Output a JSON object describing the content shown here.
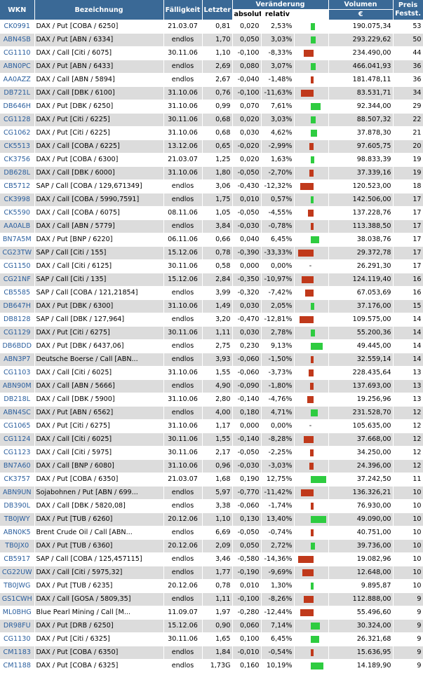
{
  "header": {
    "wkn": "WKN",
    "bezeichnung": "Bezeichnung",
    "faelligkeit": "Fälligkeit",
    "letzter": "Letzter",
    "veraenderung": "Veränderung",
    "absolut": "absolut",
    "relativ": "relativ",
    "volumen": "Volumen",
    "waehrung": "€",
    "preis_festst": "Preis Festst."
  },
  "colors": {
    "header_bg": "#3a6996",
    "positive": "#2ecc40",
    "negative": "#c0391b",
    "link": "#2b5f9e",
    "stripe": "#dcdcdc"
  },
  "rows": [
    {
      "wkn": "CK0991",
      "name": "DAX / Put [COBA / 6250]",
      "due": "21.03.07",
      "last": "0,81",
      "abs": "0,020",
      "rel": "2,53%",
      "change": 2.53,
      "vol": "190.075,34",
      "count": "53"
    },
    {
      "wkn": "ABN4SB",
      "name": "DAX / Put [ABN / 6334]",
      "due": "endlos",
      "last": "1,70",
      "abs": "0,050",
      "rel": "3,03%",
      "change": 3.03,
      "vol": "293.229,62",
      "count": "50"
    },
    {
      "wkn": "CG1110",
      "name": "DAX / Call [Citi / 6075]",
      "due": "30.11.06",
      "last": "1,10",
      "abs": "-0,100",
      "rel": "-8,33%",
      "change": -8.33,
      "vol": "234.490,00",
      "count": "44"
    },
    {
      "wkn": "ABN0PC",
      "name": "DAX / Put [ABN / 6433]",
      "due": "endlos",
      "last": "2,69",
      "abs": "0,080",
      "rel": "3,07%",
      "change": 3.07,
      "vol": "466.041,93",
      "count": "36"
    },
    {
      "wkn": "AA0AZZ",
      "name": "DAX / Call [ABN / 5894]",
      "due": "endlos",
      "last": "2,67",
      "abs": "-0,040",
      "rel": "-1,48%",
      "change": -1.48,
      "vol": "181.478,11",
      "count": "36"
    },
    {
      "wkn": "DB721L",
      "name": "DAX / Call [DBK / 6100]",
      "due": "31.10.06",
      "last": "0,76",
      "abs": "-0,100",
      "rel": "-11,63%",
      "change": -11.63,
      "vol": "83.531,71",
      "count": "34"
    },
    {
      "wkn": "DB646H",
      "name": "DAX / Put [DBK / 6250]",
      "due": "31.10.06",
      "last": "0,99",
      "abs": "0,070",
      "rel": "7,61%",
      "change": 7.61,
      "vol": "92.344,00",
      "count": "29"
    },
    {
      "wkn": "CG1128",
      "name": "DAX / Put [Citi / 6225]",
      "due": "30.11.06",
      "last": "0,68",
      "abs": "0,020",
      "rel": "3,03%",
      "change": 3.03,
      "vol": "88.507,32",
      "count": "22"
    },
    {
      "wkn": "CG1062",
      "name": "DAX / Put [Citi / 6225]",
      "due": "31.10.06",
      "last": "0,68",
      "abs": "0,030",
      "rel": "4,62%",
      "change": 4.62,
      "vol": "37.878,30",
      "count": "21"
    },
    {
      "wkn": "CK5513",
      "name": "DAX / Call [COBA / 6225]",
      "due": "13.12.06",
      "last": "0,65",
      "abs": "-0,020",
      "rel": "-2,99%",
      "change": -2.99,
      "vol": "97.605,75",
      "count": "20"
    },
    {
      "wkn": "CK3756",
      "name": "DAX / Put [COBA / 6300]",
      "due": "21.03.07",
      "last": "1,25",
      "abs": "0,020",
      "rel": "1,63%",
      "change": 1.63,
      "vol": "98.833,39",
      "count": "19"
    },
    {
      "wkn": "DB628L",
      "name": "DAX / Call [DBK / 6000]",
      "due": "31.10.06",
      "last": "1,80",
      "abs": "-0,050",
      "rel": "-2,70%",
      "change": -2.7,
      "vol": "37.339,16",
      "count": "19"
    },
    {
      "wkn": "CB5712",
      "name": "SAP / Call [COBA / 129,671349]",
      "due": "endlos",
      "last": "3,06",
      "abs": "-0,430",
      "rel": "-12,32%",
      "change": -12.32,
      "vol": "120.523,00",
      "count": "18"
    },
    {
      "wkn": "CK3998",
      "name": "DAX / Call [COBA / 5990,7591]",
      "due": "endlos",
      "last": "1,75",
      "abs": "0,010",
      "rel": "0,57%",
      "change": 0.57,
      "vol": "142.506,00",
      "count": "17"
    },
    {
      "wkn": "CK5590",
      "name": "DAX / Call [COBA / 6075]",
      "due": "08.11.06",
      "last": "1,05",
      "abs": "-0,050",
      "rel": "-4,55%",
      "change": -4.55,
      "vol": "137.228,76",
      "count": "17"
    },
    {
      "wkn": "AA0ALB",
      "name": "DAX / Call [ABN / 5779]",
      "due": "endlos",
      "last": "3,84",
      "abs": "-0,030",
      "rel": "-0,78%",
      "change": -0.78,
      "vol": "113.388,50",
      "count": "17"
    },
    {
      "wkn": "BN7A5M",
      "name": "DAX / Put [BNP / 6220]",
      "due": "06.11.06",
      "last": "0,66",
      "abs": "0,040",
      "rel": "6,45%",
      "change": 6.45,
      "vol": "38.038,76",
      "count": "17"
    },
    {
      "wkn": "CG23TW",
      "name": "SAP / Call [Citi / 155]",
      "due": "15.12.06",
      "last": "0,78",
      "abs": "-0,390",
      "rel": "-33,33%",
      "change": -33.33,
      "vol": "29.372,78",
      "count": "17"
    },
    {
      "wkn": "CG1150",
      "name": "DAX / Call [Citi / 6125]",
      "due": "30.11.06",
      "last": "0,58",
      "abs": "0,000",
      "rel": "0,00%",
      "change": 0,
      "vol": "26.291,30",
      "count": "17"
    },
    {
      "wkn": "CG21NF",
      "name": "SAP / Call [Citi / 135]",
      "due": "15.12.06",
      "last": "2,84",
      "abs": "-0,350",
      "rel": "-10,97%",
      "change": -10.97,
      "vol": "124.119,40",
      "count": "16"
    },
    {
      "wkn": "CB5585",
      "name": "SAP / Call [COBA / 121,21854]",
      "due": "endlos",
      "last": "3,99",
      "abs": "-0,320",
      "rel": "-7,42%",
      "change": -7.42,
      "vol": "67.053,69",
      "count": "16"
    },
    {
      "wkn": "DB647H",
      "name": "DAX / Put [DBK / 6300]",
      "due": "31.10.06",
      "last": "1,49",
      "abs": "0,030",
      "rel": "2,05%",
      "change": 2.05,
      "vol": "37.176,00",
      "count": "15"
    },
    {
      "wkn": "DB8128",
      "name": "SAP / Call [DBK / 127,964]",
      "due": "endlos",
      "last": "3,20",
      "abs": "-0,470",
      "rel": "-12,81%",
      "change": -12.81,
      "vol": "109.575,00",
      "count": "14"
    },
    {
      "wkn": "CG1129",
      "name": "DAX / Put [Citi / 6275]",
      "due": "30.11.06",
      "last": "1,11",
      "abs": "0,030",
      "rel": "2,78%",
      "change": 2.78,
      "vol": "55.200,36",
      "count": "14"
    },
    {
      "wkn": "DB6BDD",
      "name": "DAX / Put [DBK / 6437,06]",
      "due": "endlos",
      "last": "2,75",
      "abs": "0,230",
      "rel": "9,13%",
      "change": 9.13,
      "vol": "49.445,00",
      "count": "14"
    },
    {
      "wkn": "ABN3P7",
      "name": "Deutsche Boerse / Call [ABN...",
      "due": "endlos",
      "last": "3,93",
      "abs": "-0,060",
      "rel": "-1,50%",
      "change": -1.5,
      "vol": "32.559,14",
      "count": "14"
    },
    {
      "wkn": "CG1103",
      "name": "DAX / Call [Citi / 6025]",
      "due": "31.10.06",
      "last": "1,55",
      "abs": "-0,060",
      "rel": "-3,73%",
      "change": -3.73,
      "vol": "228.435,64",
      "count": "13"
    },
    {
      "wkn": "ABN90M",
      "name": "DAX / Call [ABN / 5666]",
      "due": "endlos",
      "last": "4,90",
      "abs": "-0,090",
      "rel": "-1,80%",
      "change": -1.8,
      "vol": "137.693,00",
      "count": "13"
    },
    {
      "wkn": "DB218L",
      "name": "DAX / Call [DBK / 5900]",
      "due": "31.10.06",
      "last": "2,80",
      "abs": "-0,140",
      "rel": "-4,76%",
      "change": -4.76,
      "vol": "19.256,96",
      "count": "13"
    },
    {
      "wkn": "ABN4SC",
      "name": "DAX / Put [ABN / 6562]",
      "due": "endlos",
      "last": "4,00",
      "abs": "0,180",
      "rel": "4,71%",
      "change": 4.71,
      "vol": "231.528,70",
      "count": "12"
    },
    {
      "wkn": "CG1065",
      "name": "DAX / Put [Citi / 6275]",
      "due": "31.10.06",
      "last": "1,17",
      "abs": "0,000",
      "rel": "0,00%",
      "change": 0,
      "vol": "105.635,00",
      "count": "12"
    },
    {
      "wkn": "CG1124",
      "name": "DAX / Call [Citi / 6025]",
      "due": "30.11.06",
      "last": "1,55",
      "abs": "-0,140",
      "rel": "-8,28%",
      "change": -8.28,
      "vol": "37.668,00",
      "count": "12"
    },
    {
      "wkn": "CG1123",
      "name": "DAX / Call [Citi / 5975]",
      "due": "30.11.06",
      "last": "2,17",
      "abs": "-0,050",
      "rel": "-2,25%",
      "change": -2.25,
      "vol": "34.250,00",
      "count": "12"
    },
    {
      "wkn": "BN7A60",
      "name": "DAX / Call [BNP / 6080]",
      "due": "31.10.06",
      "last": "0,96",
      "abs": "-0,030",
      "rel": "-3,03%",
      "change": -3.03,
      "vol": "24.396,00",
      "count": "12"
    },
    {
      "wkn": "CK3757",
      "name": "DAX / Put [COBA / 6350]",
      "due": "21.03.07",
      "last": "1,68",
      "abs": "0,190",
      "rel": "12,75%",
      "change": 12.75,
      "vol": "37.242,50",
      "count": "11"
    },
    {
      "wkn": "ABN9UN",
      "name": "Sojabohnen / Put [ABN / 699...",
      "due": "endlos",
      "last": "5,97",
      "abs": "-0,770",
      "rel": "-11,42%",
      "change": -11.42,
      "vol": "136.326,21",
      "count": "10"
    },
    {
      "wkn": "DB390L",
      "name": "DAX / Call [DBK / 5820,08]",
      "due": "endlos",
      "last": "3,38",
      "abs": "-0,060",
      "rel": "-1,74%",
      "change": -1.74,
      "vol": "76.930,00",
      "count": "10"
    },
    {
      "wkn": "TB0JWY",
      "name": "DAX / Put [TUB / 6260]",
      "due": "20.12.06",
      "last": "1,10",
      "abs": "0,130",
      "rel": "13,40%",
      "change": 13.4,
      "vol": "49.090,00",
      "count": "10"
    },
    {
      "wkn": "ABN0K5",
      "name": "Brent Crude Oil / Call [ABN...",
      "due": "endlos",
      "last": "6,69",
      "abs": "-0,050",
      "rel": "-0,74%",
      "change": -0.74,
      "vol": "40.751,00",
      "count": "10"
    },
    {
      "wkn": "TB0JX0",
      "name": "DAX / Put [TUB / 6360]",
      "due": "20.12.06",
      "last": "2,09",
      "abs": "0,050",
      "rel": "2,72%",
      "change": 2.72,
      "vol": "39.736,00",
      "count": "10"
    },
    {
      "wkn": "CB5917",
      "name": "SAP / Call [COBA / 125,457115]",
      "due": "endlos",
      "last": "3,46",
      "abs": "-0,580",
      "rel": "-14,36%",
      "change": -14.36,
      "vol": "19.082,96",
      "count": "10"
    },
    {
      "wkn": "CG22UW",
      "name": "DAX / Call [Citi / 5975,32]",
      "due": "endlos",
      "last": "1,77",
      "abs": "-0,190",
      "rel": "-9,69%",
      "change": -9.69,
      "vol": "12.648,00",
      "count": "10"
    },
    {
      "wkn": "TB0JWG",
      "name": "DAX / Put [TUB / 6235]",
      "due": "20.12.06",
      "last": "0,78",
      "abs": "0,010",
      "rel": "1,30%",
      "change": 1.3,
      "vol": "9.895,87",
      "count": "10"
    },
    {
      "wkn": "GS1CWH",
      "name": "DAX / Call [GOSA / 5809,35]",
      "due": "endlos",
      "last": "1,11",
      "abs": "-0,100",
      "rel": "-8,26%",
      "change": -8.26,
      "vol": "112.888,00",
      "count": "9"
    },
    {
      "wkn": "ML0BHG",
      "name": "Blue Pearl Mining / Call [M...",
      "due": "11.09.07",
      "last": "1,97",
      "abs": "-0,280",
      "rel": "-12,44%",
      "change": -12.44,
      "vol": "55.496,60",
      "count": "9"
    },
    {
      "wkn": "DR98FU",
      "name": "DAX / Put [DRB / 6250]",
      "due": "15.12.06",
      "last": "0,90",
      "abs": "0,060",
      "rel": "7,14%",
      "change": 7.14,
      "vol": "30.324,00",
      "count": "9"
    },
    {
      "wkn": "CG1130",
      "name": "DAX / Put [Citi / 6325]",
      "due": "30.11.06",
      "last": "1,65",
      "abs": "0,100",
      "rel": "6,45%",
      "change": 6.45,
      "vol": "26.321,68",
      "count": "9"
    },
    {
      "wkn": "CM1183",
      "name": "DAX / Put [COBA / 6350]",
      "due": "endlos",
      "last": "1,84",
      "abs": "-0,010",
      "rel": "-0,54%",
      "change": -0.54,
      "vol": "15.636,95",
      "count": "9"
    },
    {
      "wkn": "CM1188",
      "name": "DAX / Put [COBA / 6325]",
      "due": "endlos",
      "last": "1,73G",
      "abs": "0,160",
      "rel": "10,19%",
      "change": 10.19,
      "vol": "14.189,90",
      "count": "9"
    }
  ]
}
